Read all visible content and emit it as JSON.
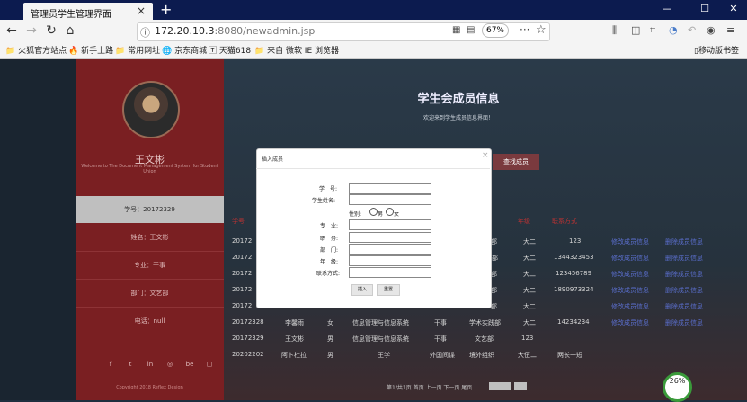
{
  "browser": {
    "tab_title": "管理员学生管理界面",
    "url_host": "172.20.10.3",
    "url_rest": ":8080/newadmin.jsp",
    "zoom": "67%",
    "bookmarks": [
      "火狐官方站点",
      "新手上路",
      "常用网址",
      "京东商城",
      "天猫618",
      "来自 微软 IE 浏览器"
    ],
    "mobile_bookmarks": "移动版书签"
  },
  "sidebar": {
    "name": "王文彬",
    "desc": "Welcome to The Document Management System for Student Union",
    "items": [
      "学号：20172329",
      "姓名：王文彬",
      "专业：干事",
      "部门：文艺部",
      "电话：null"
    ],
    "social": [
      "f",
      "t",
      "in",
      "◎",
      "be",
      "▢"
    ],
    "copyright": "Copyright 2018 Reflex Design"
  },
  "main": {
    "title": "学生会成员信息",
    "subtitle": "欢迎来到学生成员信息界面！",
    "search_button": "查找成员",
    "header_row": {
      "c1": "学号",
      "c2": "年级",
      "c3": "联系方式"
    },
    "rows": [
      {
        "id": "20172",
        "dept": "部",
        "grade": "大二",
        "phone": "123",
        "a": "修改成员信息",
        "b": "删除成员信息"
      },
      {
        "id": "20172",
        "dept": "监部",
        "grade": "大二",
        "phone": "1344323453",
        "a": "修改成员信息",
        "b": "删除成员信息"
      },
      {
        "id": "20172",
        "dept": "部",
        "grade": "大二",
        "phone": "123456789",
        "a": "修改成员信息",
        "b": "删除成员信息"
      },
      {
        "id": "20172",
        "dept": "部",
        "grade": "大二",
        "phone": "1890973324",
        "a": "修改成员信息",
        "b": "删除成员信息"
      },
      {
        "id": "20172",
        "dept": "部",
        "grade": "大二",
        "phone": "",
        "a": "修改成员信息",
        "b": "删除成员信息"
      },
      {
        "id": "20172328",
        "name": "李馨雨",
        "sex": "女",
        "major": "信息管理与信息系统",
        "role": "干事",
        "dept": "学术实践部",
        "grade": "大二",
        "phone": "14234234",
        "a": "修改成员信息",
        "b": "删除成员信息"
      },
      {
        "id": "20172329",
        "name": "王文彬",
        "sex": "男",
        "major": "信息管理与信息系统",
        "role": "干事",
        "dept": "文艺部",
        "grade": "123",
        "phone": "",
        "a": "",
        "b": ""
      },
      {
        "id": "20202202",
        "name": "阿卜杜拉",
        "sex": "男",
        "major": "王学",
        "role": "外国间谍",
        "dept": "境外组织",
        "grade": "大伍二",
        "phone": "两长一短",
        "a": "",
        "b": ""
      }
    ],
    "pager": "第1/共1页 首页 上一页 下一页 尾页"
  },
  "badge": "26%",
  "modal": {
    "title": "插入成员",
    "close": "×",
    "labels": {
      "id": "学　号:",
      "name": "学生姓名:",
      "sex": "性别:",
      "male": "男",
      "female": "女",
      "major": "专　业:",
      "role": "职　务:",
      "dept": "部　门:",
      "grade": "年　级:",
      "phone": "联系方式:"
    },
    "insert": "插入",
    "reset": "重置"
  }
}
